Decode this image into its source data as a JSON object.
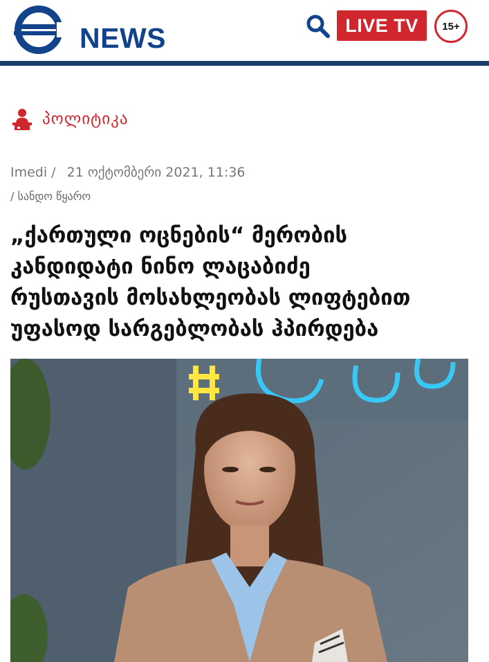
{
  "header": {
    "logo_text": "NEWS",
    "search_icon": "search-icon",
    "live_label": "LIVE TV",
    "age_rating": "15+",
    "colors": {
      "brand_blue": "#13438a",
      "live_red": "#d0262d",
      "rule": "#1a3c6b"
    }
  },
  "category": {
    "icon": "speaker-podium-icon",
    "label": "პოლიტიკა"
  },
  "meta": {
    "source": "Imedi /",
    "date": "21 ოქტომბერი 2021, 11:36",
    "source_link": "/ სანდო წყარო"
  },
  "headline": {
    "lines": [
      "„ქართული ოცნების“ მერობის",
      "კანდიდატი ნინო ლაცაბიძე",
      "რუსთავის მოსახლეობას ლიფტებით",
      "უფასოდ სარგებლობას ჰპირდება"
    ]
  }
}
